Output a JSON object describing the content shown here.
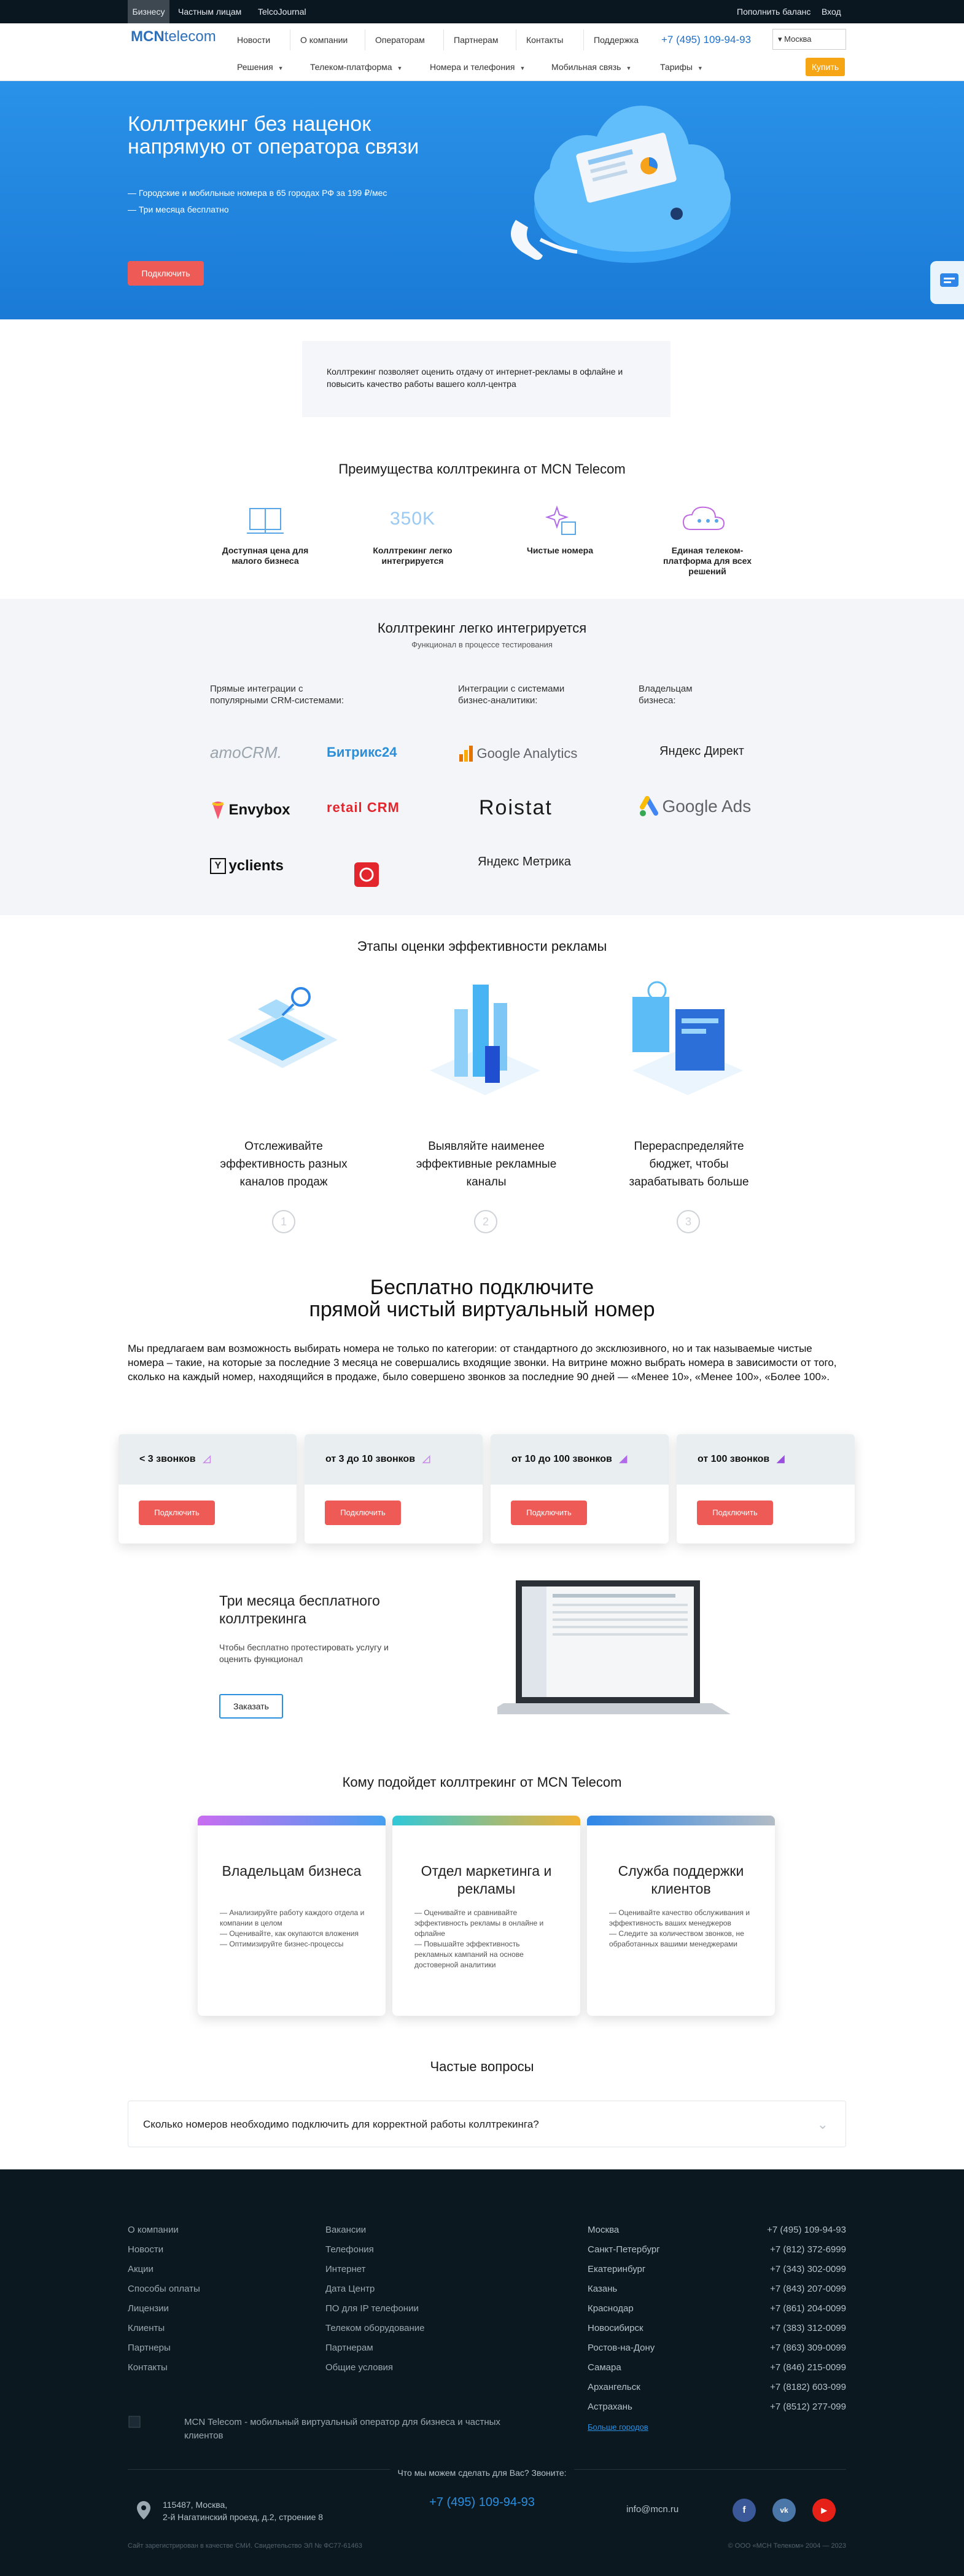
{
  "topbar": {
    "tabs": [
      "Бизнесу",
      "Частным лицам",
      "TelcoJournal"
    ],
    "topup": "Пополнить баланс",
    "login": "Вход"
  },
  "header": {
    "logo_bold": "MCN",
    "logo_rest": "telecom",
    "nav": [
      "Новости",
      "О компании",
      "Операторам",
      "Партнерам",
      "Контакты",
      "Поддержка"
    ],
    "phone": "+7 (495) 109-94-93",
    "city": "Москва",
    "menu": [
      "Решения",
      "Телеком-платформа",
      "Номера и телефония",
      "Мобильная связь",
      "Тарифы"
    ],
    "buy": "Купить"
  },
  "hero": {
    "title": "Коллтрекинг без наценок напрямую от оператора связи",
    "bullets": [
      "Городские и мобильные номера в 65 городах РФ за 199 ₽/мес",
      "Три месяца бесплатно"
    ],
    "button": "Подключить"
  },
  "intro": "Коллтрекинг позволяет оценить отдачу от интернет-рекламы в офлайне и повысить качество работы вашего колл-центра",
  "advantages": {
    "title": "Преимущества коллтрекинга от MCN Telecom",
    "items": [
      {
        "label": "Доступная цена для малого бизнеса",
        "icon": "scale-icon"
      },
      {
        "label": "Коллтрекинг легко интегрируется",
        "icon": "350k-icon",
        "icon_text": "350K"
      },
      {
        "label": "Чистые номера",
        "icon": "sparkle-icon"
      },
      {
        "label": "Единая телеком-платформа для всех решений",
        "icon": "cloud-icon"
      }
    ]
  },
  "integrations": {
    "title": "Коллтрекинг легко интегрируется",
    "subtitle": "Функционал в процессе тестирования",
    "col1": "Прямые интеграции с популярными CRM-системами:",
    "col2": "Интеграции с системами бизнес-аналитики:",
    "col3": "Владельцам бизнеса:",
    "brands": {
      "amocrm": "amoCRM.",
      "bitrix": "Битрикс24",
      "ga": "Google Analytics",
      "ydirect": "Яндекс Директ",
      "envybox": "Envybox",
      "retailcrm": "retail CRM",
      "roistat": "Roistat",
      "gads": "Google Ads",
      "yclients": "yclients",
      "ymetrika": "Яндекс Метрика"
    }
  },
  "stages": {
    "title": "Этапы оценки эффективности рекламы",
    "items": [
      {
        "text": "Отслеживайте эффективность разных каналов продаж",
        "num": "1"
      },
      {
        "text": "Выявляйте наименее эффективные рекламные каналы",
        "num": "2"
      },
      {
        "text": "Перераспределяйте бюджет, чтобы зарабатывать больше",
        "num": "3"
      }
    ]
  },
  "free": {
    "title1": "Бесплатно подключите",
    "title2": "прямой чистый виртуальный номер",
    "text": "Мы предлагаем вам возможность выбирать номера не только по категории: от стандартного до эксклюзивного, но и так называемые чистые номера – такие, на которые за последние 3 месяца не совершались входящие звонки. На витрине можно выбрать номера в зависимости от того, сколько на каждый номер, находящийся в продаже, было совершено звонков за последние 90 дней — «Менее 10», «Менее 100», «Более 100».",
    "cards": [
      {
        "label": "< 3 звонков",
        "button": "Подключить"
      },
      {
        "label": "от 3 до 10 звонков",
        "button": "Подключить"
      },
      {
        "label": "от 10 до 100 звонков",
        "button": "Подключить"
      },
      {
        "label": "от 100 звонков",
        "button": "Подключить"
      }
    ]
  },
  "trial": {
    "title": "Три месяца бесплатного коллтрекинга",
    "text": "Чтобы бесплатно протестировать услугу и оценить функционал",
    "button": "Заказать"
  },
  "who": {
    "title": "Кому подойдет коллтрекинг от MCN Telecom",
    "cards": [
      {
        "title": "Владельцам бизнеса",
        "text": "— Анализируйте работу каждого отдела и компании в целом\n— Оценивайте, как окупаются вложения\n— Оптимизируйте бизнес-процессы",
        "bar": "#c86cf0"
      },
      {
        "title": "Отдел маркетинга и рекламы",
        "text": "— Оценивайте и сравнивайте эффективность рекламы в онлайне и офлайне\n— Повышайте эффективность рекламных кампаний на основе достоверной аналитики",
        "bar": "#f3b132"
      },
      {
        "title": "Служба поддержки клиентов",
        "text": "— Оценивайте качество обслуживания и эффективность ваших менеджеров\n— Следите за количеством звонков, не обработанных вашими менеджерами",
        "bar": "#2d86e8"
      }
    ]
  },
  "faq": {
    "title": "Частые вопросы",
    "q1": "Сколько номеров необходимо подключить для корректной работы коллтрекинга?"
  },
  "footer": {
    "col1": [
      "О компании",
      "Новости",
      "Акции",
      "Способы оплаты",
      "Лицензии",
      "Клиенты",
      "Партнеры",
      "Контакты"
    ],
    "col2": [
      "Вакансии",
      "Телефония",
      "Интернет",
      "Дата Центр",
      "ПО для IP телефонии",
      "Телеком оборудование",
      "Партнерам",
      "Общие условия"
    ],
    "cities": [
      "Москва",
      "Санкт-Петербург",
      "Екатеринбург",
      "Казань",
      "Краснодар",
      "Новосибирск",
      "Ростов-на-Дону",
      "Самара",
      "Архангельск",
      "Астрахань"
    ],
    "phones": [
      "+7 (495) 109-94-93",
      "+7 (812) 372-6999",
      "+7 (343) 302-0099",
      "+7 (843) 207-0099",
      "+7 (861) 204-0099",
      "+7 (383) 312-0099",
      "+7 (863) 309-0099",
      "+7 (846) 215-0099",
      "+7 (8182) 603-099",
      "+7 (8512) 277-099"
    ],
    "about": "MCN Telecom - мобильный виртуальный оператор для бизнеса и частных клиентов",
    "more_cities": "Больше городов",
    "call_prompt": "Что мы можем сделать для Вас? Звоните:",
    "address": "115487, Москва,\n2-й Нагатинский проезд, д.2, строение 8",
    "phone": "+7 (495) 109-94-93",
    "email": "info@mcn.ru",
    "legal": "Сайт зарегистрирован в качестве СМИ. Свидетельство ЭЛ № ФС77-61463",
    "copyright": "© ООО «МСН Телеком» 2004 — 2023",
    "social": [
      {
        "name": "facebook-icon",
        "glyph": "f",
        "color": "#3b5998"
      },
      {
        "name": "vk-icon",
        "glyph": "vk",
        "color": "#4a76a8"
      },
      {
        "name": "youtube-icon",
        "glyph": "▶",
        "color": "#e62117"
      }
    ]
  }
}
